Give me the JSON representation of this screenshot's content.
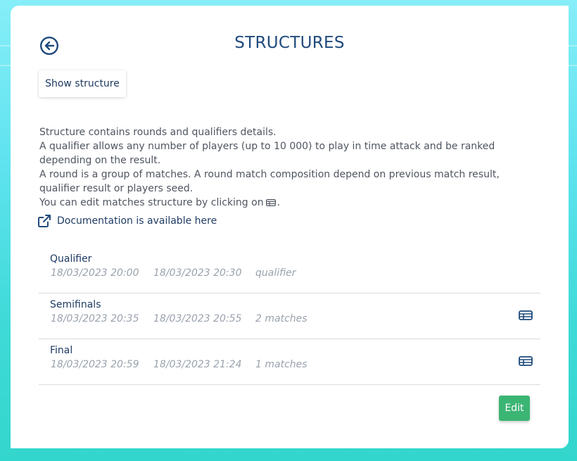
{
  "page": {
    "title": "STRUCTURES",
    "back_icon": "arrow-left-circle-icon"
  },
  "toolbar": {
    "show_structure_label": "Show structure"
  },
  "description": {
    "line1": "Structure contains rounds and qualifiers details.",
    "line2": "A qualifier allows any number of players (up to 10 000) to play in time attack and be ranked depending on the result.",
    "line3": "A round is a group of matches. A round match composition depend on previous match result, qualifier result or players seed.",
    "line4_prefix": "You can edit matches structure by clicking on",
    "line4_suffix": ".",
    "inline_icon": "table-icon"
  },
  "documentation": {
    "label": "Documentation is available here",
    "icon": "external-link-icon"
  },
  "rounds": [
    {
      "name": "Qualifier",
      "start": "18/03/2023 20:00",
      "end": "18/03/2023 20:30",
      "info": "qualifier",
      "editable": false
    },
    {
      "name": "Semifinals",
      "start": "18/03/2023 20:35",
      "end": "18/03/2023 20:55",
      "info": "2 matches",
      "editable": true
    },
    {
      "name": "Final",
      "start": "18/03/2023 20:59",
      "end": "18/03/2023 21:24",
      "info": "1 matches",
      "editable": true
    }
  ],
  "footer": {
    "edit_label": "Edit"
  },
  "colors": {
    "primary": "#1f4a7c",
    "text_dark": "#1f3b63",
    "muted": "#9aa2ad",
    "success": "#3bb573",
    "background_top": "#86eef8",
    "background_bottom": "#33d6cc"
  }
}
